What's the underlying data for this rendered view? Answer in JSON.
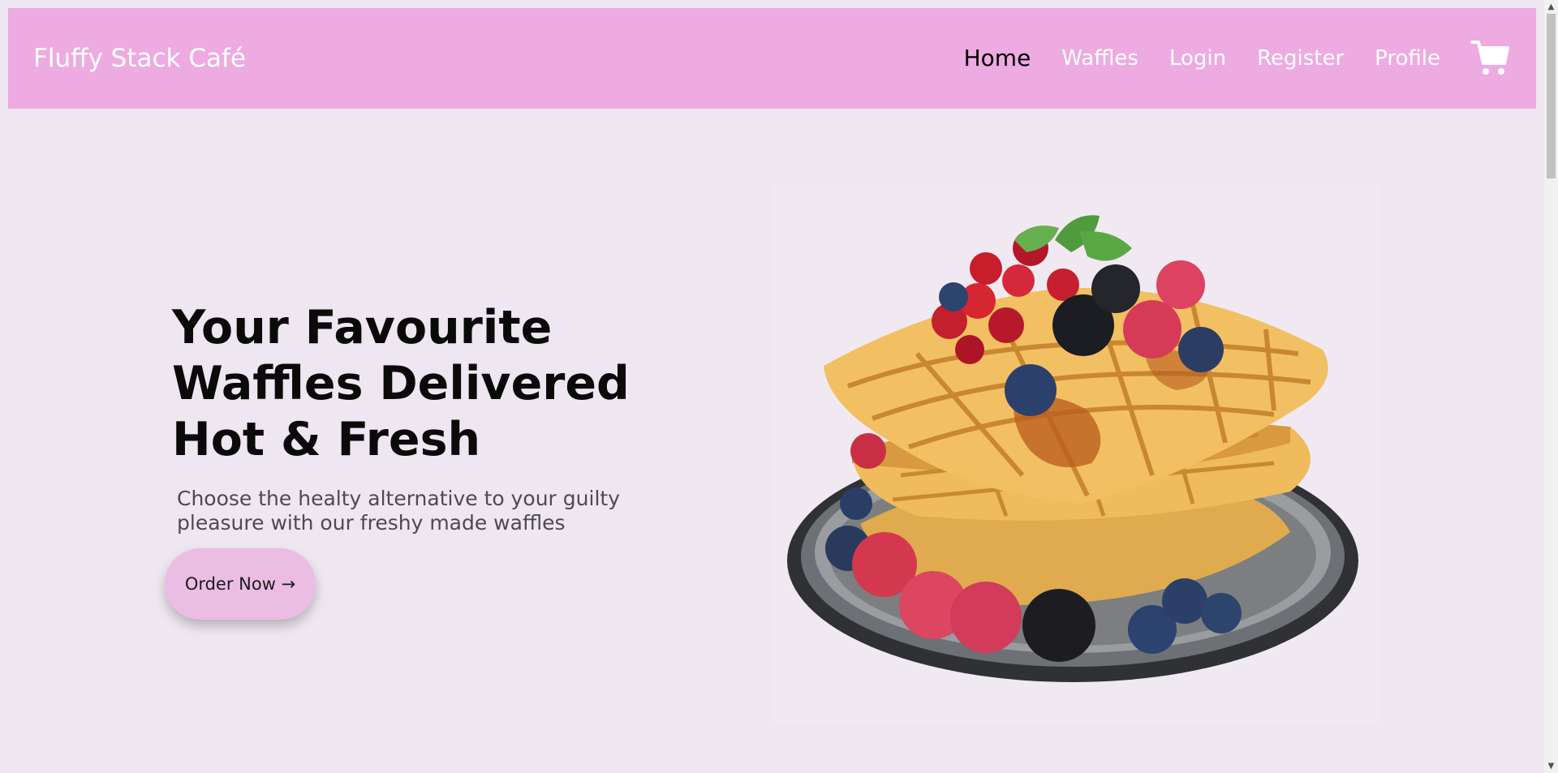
{
  "navbar": {
    "brand": "Fluffy Stack Café",
    "links": [
      {
        "label": "Home",
        "active": true
      },
      {
        "label": "Waffles",
        "active": false
      },
      {
        "label": "Login",
        "active": false
      },
      {
        "label": "Register",
        "active": false
      },
      {
        "label": "Profile",
        "active": false
      }
    ],
    "cart_icon": "shopping-cart-icon"
  },
  "hero": {
    "title": "Your Favourite Waffles Delivered Hot & Fresh",
    "subtitle": "Choose the healty alternative to your guilty pleasure with our freshy made waffles",
    "cta_label": "Order Now →",
    "image": "waffle-stack-image"
  },
  "colors": {
    "page_background": "#eee6f0",
    "navbar_background": "#edabe1",
    "nav_text": "#ffffff",
    "nav_active_text": "#000000",
    "cta_background": "#ebbde3"
  }
}
